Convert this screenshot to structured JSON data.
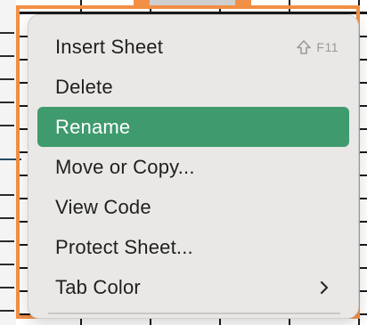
{
  "context_menu": {
    "items": [
      {
        "label": "Insert Sheet",
        "shortcut_key": "F11",
        "shortcut_modifier": "shift-icon",
        "selected": false
      },
      {
        "label": "Delete",
        "selected": false
      },
      {
        "label": "Rename",
        "selected": true
      },
      {
        "label": "Move or Copy...",
        "selected": false
      },
      {
        "label": "View Code",
        "selected": false
      },
      {
        "label": "Protect Sheet...",
        "selected": false
      },
      {
        "label": "Tab Color",
        "submenu_icon": "chevron-right-icon",
        "selected": false
      }
    ]
  },
  "colors": {
    "highlight_frame": "#f29045",
    "selected_item": "#3f9a6e",
    "menu_background": "#e9e8e6",
    "connector_line": "#274b66"
  }
}
